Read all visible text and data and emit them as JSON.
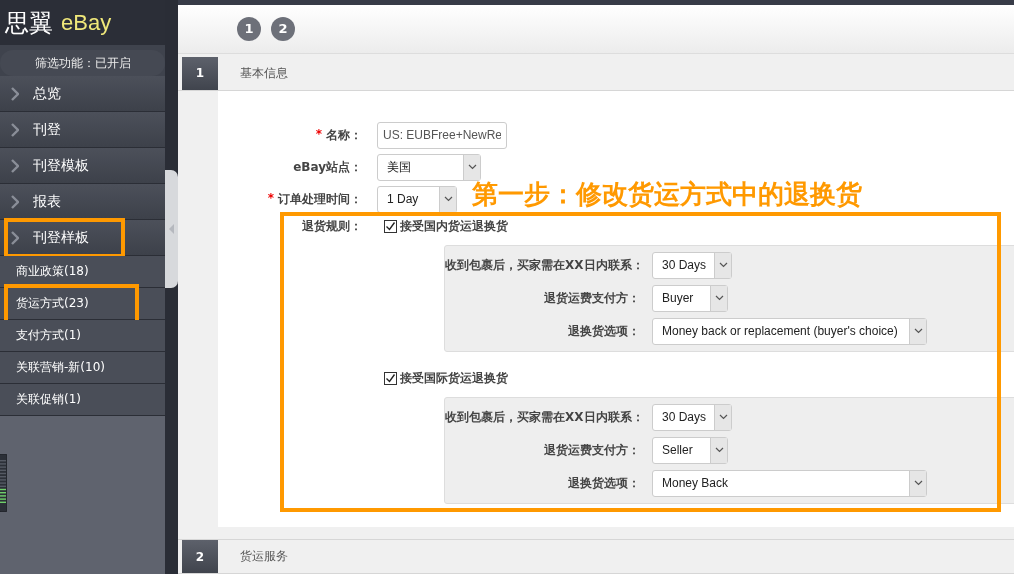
{
  "logo": {
    "name": "思翼",
    "product": "eBay"
  },
  "filter_status": "筛选功能：已开启",
  "menu": [
    {
      "label": "总览",
      "kind": "section",
      "annotated": false
    },
    {
      "label": "刊登",
      "kind": "section",
      "annotated": false
    },
    {
      "label": "刊登模板",
      "kind": "section",
      "annotated": false
    },
    {
      "label": "报表",
      "kind": "section",
      "annotated": false
    },
    {
      "label": "刊登样板",
      "kind": "section",
      "annotated": true
    },
    {
      "label": "商业政策(18)",
      "kind": "sub",
      "annotated": false
    },
    {
      "label": "货运方式(23)",
      "kind": "sub",
      "annotated": true
    },
    {
      "label": "支付方式(1)",
      "kind": "sub",
      "annotated": false
    },
    {
      "label": "关联营销-新(10)",
      "kind": "sub",
      "annotated": false
    },
    {
      "label": "关联促销(1)",
      "kind": "sub",
      "annotated": false
    }
  ],
  "steps": [
    "1",
    "2"
  ],
  "sections": [
    {
      "number": "1",
      "title": "基本信息"
    },
    {
      "number": "2",
      "title": "货运服务"
    }
  ],
  "basic_fields": [
    {
      "label": "名称：",
      "required_mark": "*",
      "kind": "text",
      "value": "US: EUBFree+NewRe"
    },
    {
      "label": "eBay站点：",
      "kind": "select",
      "value": "美国"
    },
    {
      "label": "订单处理时间：",
      "required_mark": "*",
      "kind": "select",
      "value": "1 Day"
    }
  ],
  "annotation": "第一步：修改货运方式中的退换货",
  "return_rules": {
    "label": "退货规则：",
    "groups": [
      {
        "label": "接受国内货运退换货",
        "checked": true,
        "fields": [
          {
            "label": "收到包裹后，买家需在XX日内联系：",
            "value": "30 Days"
          },
          {
            "label": "退货运费支付方：",
            "value": "Buyer"
          },
          {
            "label": "退换货选项：",
            "value": "Money back or replacement (buyer's choice)"
          }
        ]
      },
      {
        "label": "接受国际货运退换货",
        "checked": true,
        "fields": [
          {
            "label": "收到包裹后，买家需在XX日内联系：",
            "value": "30 Days"
          },
          {
            "label": "退货运费支付方：",
            "value": "Seller"
          },
          {
            "label": "退换货选项：",
            "value": "Money Back"
          }
        ]
      }
    ]
  }
}
